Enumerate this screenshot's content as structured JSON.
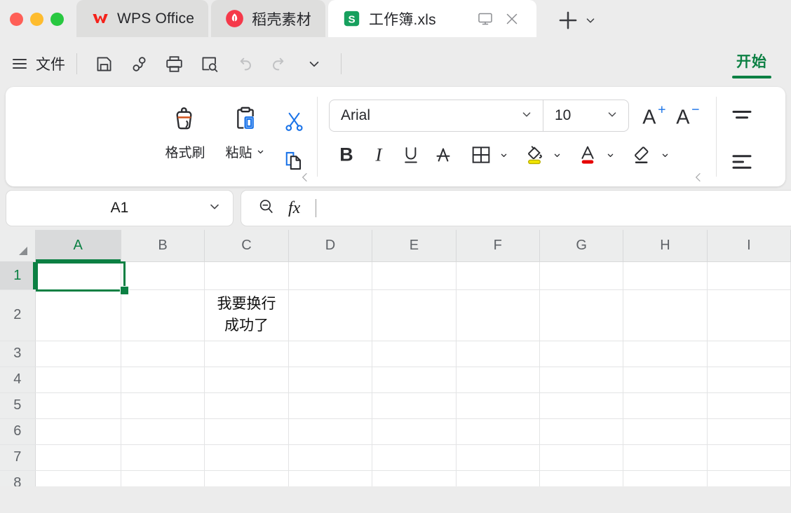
{
  "window": {
    "traffic_lights": [
      "close",
      "minimize",
      "maximize"
    ],
    "tabs": [
      {
        "title": "WPS Office",
        "icon": "wps-logo-icon",
        "active": false
      },
      {
        "title": "稻壳素材",
        "icon": "docer-icon",
        "active": false
      },
      {
        "title": "工作簿.xls",
        "icon": "spreadsheet-icon",
        "active": true
      }
    ],
    "tab_actions": [
      "present-icon",
      "close-icon"
    ],
    "new_tab_label": "+"
  },
  "menubar": {
    "file_label": "文件",
    "quick_access": [
      "save-icon",
      "share-icon",
      "print-icon",
      "print-preview-icon",
      "undo-icon",
      "redo-icon",
      "customize-chevron-icon"
    ],
    "ribbon_tab": "开始"
  },
  "ribbon": {
    "clipboard": {
      "format_painter_label": "格式刷",
      "paste_label": "粘贴",
      "cut_icon": "scissors-icon",
      "copy_icon": "copy-icon",
      "launcher": "dialog-launcher-icon"
    },
    "font": {
      "font_name": "Arial",
      "font_size": "10",
      "increase_size_label": "A",
      "increase_size_sup": "+",
      "decrease_size_label": "A",
      "decrease_size_sup": "−",
      "bold_label": "B",
      "italic_label": "I",
      "underline_label": "U",
      "strikethrough_icon": "strikethrough-icon",
      "borders_icon": "borders-icon",
      "fill_color_icon": "fill-color-icon",
      "fill_color": "#f2e600",
      "font_color_icon": "font-color-icon",
      "font_color": "#e60000",
      "clear_format_icon": "eraser-icon",
      "launcher": "dialog-launcher-icon"
    },
    "align": {
      "vertical_align_icon": "align-middle-icon",
      "horizontal_align_icon": "align-left-icon"
    }
  },
  "formula_bar": {
    "name_box_value": "A1",
    "name_box_chevron": "chevron-down-icon",
    "search_icon": "zoom-out-icon",
    "fx_label": "fx",
    "formula_value": ""
  },
  "sheet": {
    "columns": [
      "A",
      "B",
      "C",
      "D",
      "E",
      "F",
      "G",
      "H",
      "I"
    ],
    "selected_column": "A",
    "rows": [
      "1",
      "2",
      "3",
      "4",
      "5",
      "6",
      "7",
      "8"
    ],
    "selected_row": "1",
    "active_cell": "A1",
    "cells": [
      {
        "ref": "C2",
        "lines": [
          "我要换行",
          "成功了"
        ]
      }
    ],
    "colors": {
      "selection": "#0b8043",
      "header_bg": "#eceded",
      "header_selected_bg": "#d9dadb",
      "gridline": "#e3e4e5"
    }
  }
}
